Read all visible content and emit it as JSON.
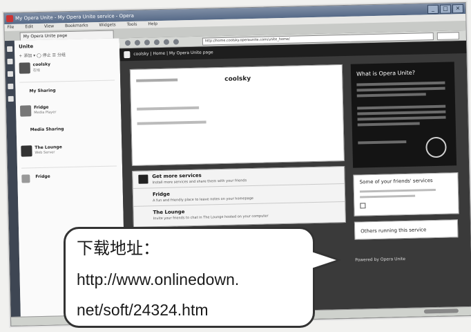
{
  "window": {
    "title": "My Opera Unite - My Opera Unite service - Opera",
    "controls": [
      "_",
      "□",
      "×"
    ]
  },
  "menubar": {
    "items": [
      "File",
      "Edit",
      "View",
      "Bookmarks",
      "Widgets",
      "Tools",
      "Help"
    ]
  },
  "tab": {
    "label": "My Opera Unite page"
  },
  "unite_panel": {
    "title": "Unite",
    "tools": "+ 添加 ▾   ◯ 停止   ☰ 分组",
    "items": [
      {
        "name": "coolsky",
        "sub": "在线"
      },
      {
        "name": "My Sharing",
        "sub": ""
      },
      {
        "name": "Fridge",
        "sub": "Media Player"
      },
      {
        "name": "Media Sharing",
        "sub": ""
      },
      {
        "name": "The Lounge",
        "sub": "Web Server"
      },
      {
        "name": "Fridge",
        "sub": ""
      }
    ]
  },
  "address": {
    "value": "http://home.coolsky.operaunite.com/unite_home/"
  },
  "page": {
    "breadcrumb": [
      "coolsky",
      "Home",
      "My Opera Unite page"
    ],
    "owner_name": "coolsky",
    "services_heading": "Get more services",
    "services": [
      {
        "title": "Get more services",
        "desc": "Install more services and share them with your friends"
      },
      {
        "title": "Fridge",
        "desc": "A fun and friendly place to leave notes on your homepage"
      },
      {
        "title": "The Lounge",
        "desc": "Invite your friends to chat in The Lounge hosted on your computer"
      }
    ],
    "whatis_title": "What is Opera Unite?",
    "friends_title": "Some of your friends' services",
    "others_label": "Others running this service",
    "powered_by": "Powered by Opera Unite"
  },
  "callout": {
    "title": "下载地址：",
    "line1": "http://www.onlinedown.",
    "line2": "net/soft/24324.htm"
  }
}
